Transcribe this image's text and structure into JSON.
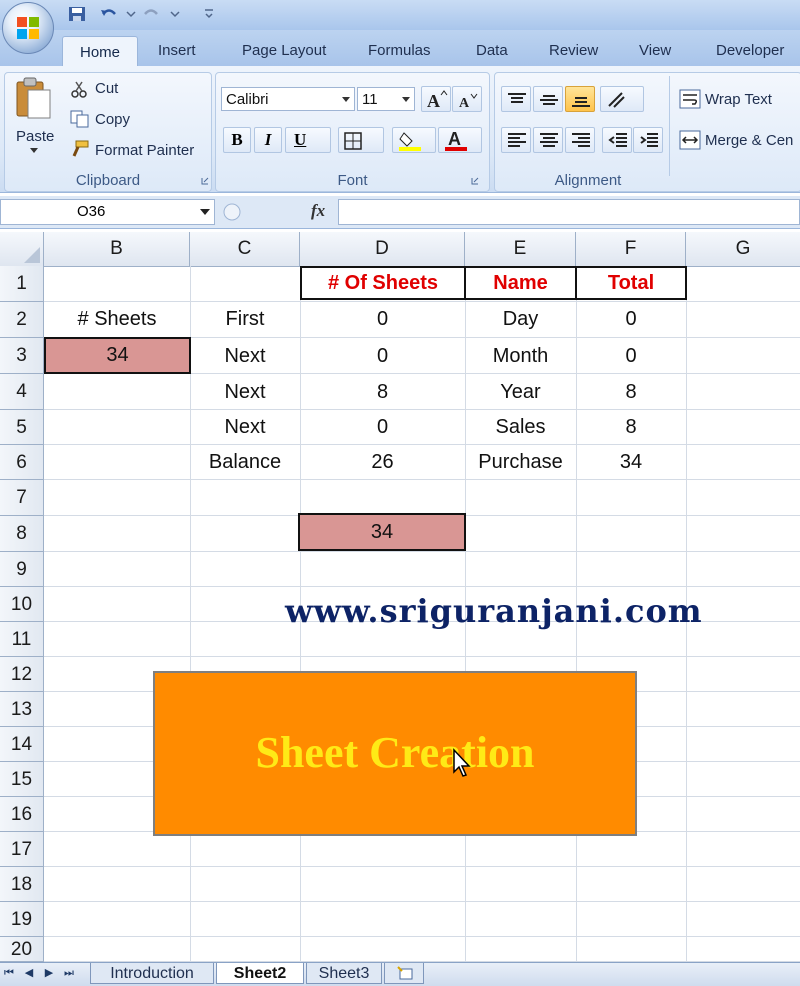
{
  "ribbon": {
    "tabs": [
      "Home",
      "Insert",
      "Page Layout",
      "Formulas",
      "Data",
      "Review",
      "View",
      "Developer"
    ],
    "clipboard": {
      "paste": "Paste",
      "cut": "Cut",
      "copy": "Copy",
      "format_painter": "Format Painter",
      "label": "Clipboard"
    },
    "font": {
      "name": "Calibri",
      "size": "11",
      "bold": "B",
      "italic": "I",
      "underline": "U",
      "label": "Font"
    },
    "alignment": {
      "wrap_text": "Wrap Text",
      "merge": "Merge & Cen",
      "label": "Alignment"
    }
  },
  "formula_bar": {
    "name_box": "O36",
    "fx": "fx"
  },
  "columns": [
    "B",
    "C",
    "D",
    "E",
    "F",
    "G"
  ],
  "rows": [
    "1",
    "2",
    "3",
    "4",
    "5",
    "6",
    "7",
    "8",
    "9",
    "10",
    "11",
    "12",
    "13",
    "14",
    "15",
    "16",
    "17",
    "18",
    "19",
    "20"
  ],
  "cells": {
    "D1": "# Of Sheets",
    "E1": "Name",
    "F1": "Total",
    "B2": "# Sheets",
    "C2": "First",
    "D2": "0",
    "E2": "Day",
    "F2": "0",
    "B3": "34",
    "C3": "Next",
    "D3": "0",
    "E3": "Month",
    "F3": "0",
    "C4": "Next",
    "D4": "8",
    "E4": "Year",
    "F4": "8",
    "C5": "Next",
    "D5": "0",
    "E5": "Sales",
    "F5": "8",
    "C6": "Balance",
    "D6": "26",
    "E6": "Purchase",
    "F6": "34",
    "D8": "34"
  },
  "website": "www.sriguranjani.com",
  "shape_button": "Sheet Creation",
  "sheet_tabs": [
    "Introduction",
    "Sheet2",
    "Sheet3"
  ],
  "colors": {
    "header_red": "#e00000",
    "pink_fill": "#d99694",
    "button_orange": "#ff8b00",
    "button_text": "#ffea16",
    "website_navy": "#0d2366"
  }
}
